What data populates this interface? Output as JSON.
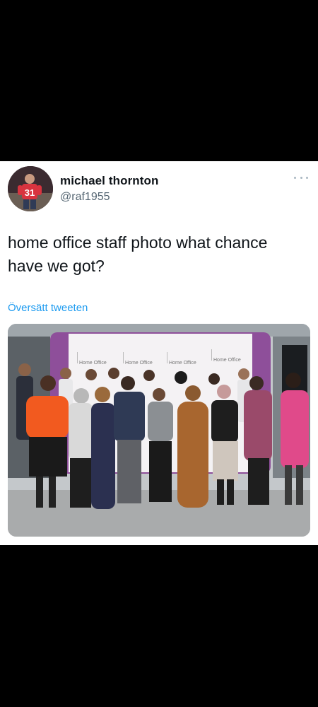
{
  "tweet": {
    "display_name": "michael thornton",
    "handle": "@raf1955",
    "text": "home office staff photo what chance have we got?",
    "translate_label": "Översätt tweeten",
    "avatar_jersey_number": "31"
  },
  "media": {
    "banner_labels": [
      "Home Office",
      "Home Office",
      "Home Office",
      "Home Office"
    ]
  },
  "icons": {
    "more": "more-options-icon"
  },
  "colors": {
    "background": "#000000",
    "card": "#ffffff",
    "name": "#0f1419",
    "handle": "#536471",
    "link": "#1d9bf0",
    "banner_purple": "#8e4f9a"
  }
}
